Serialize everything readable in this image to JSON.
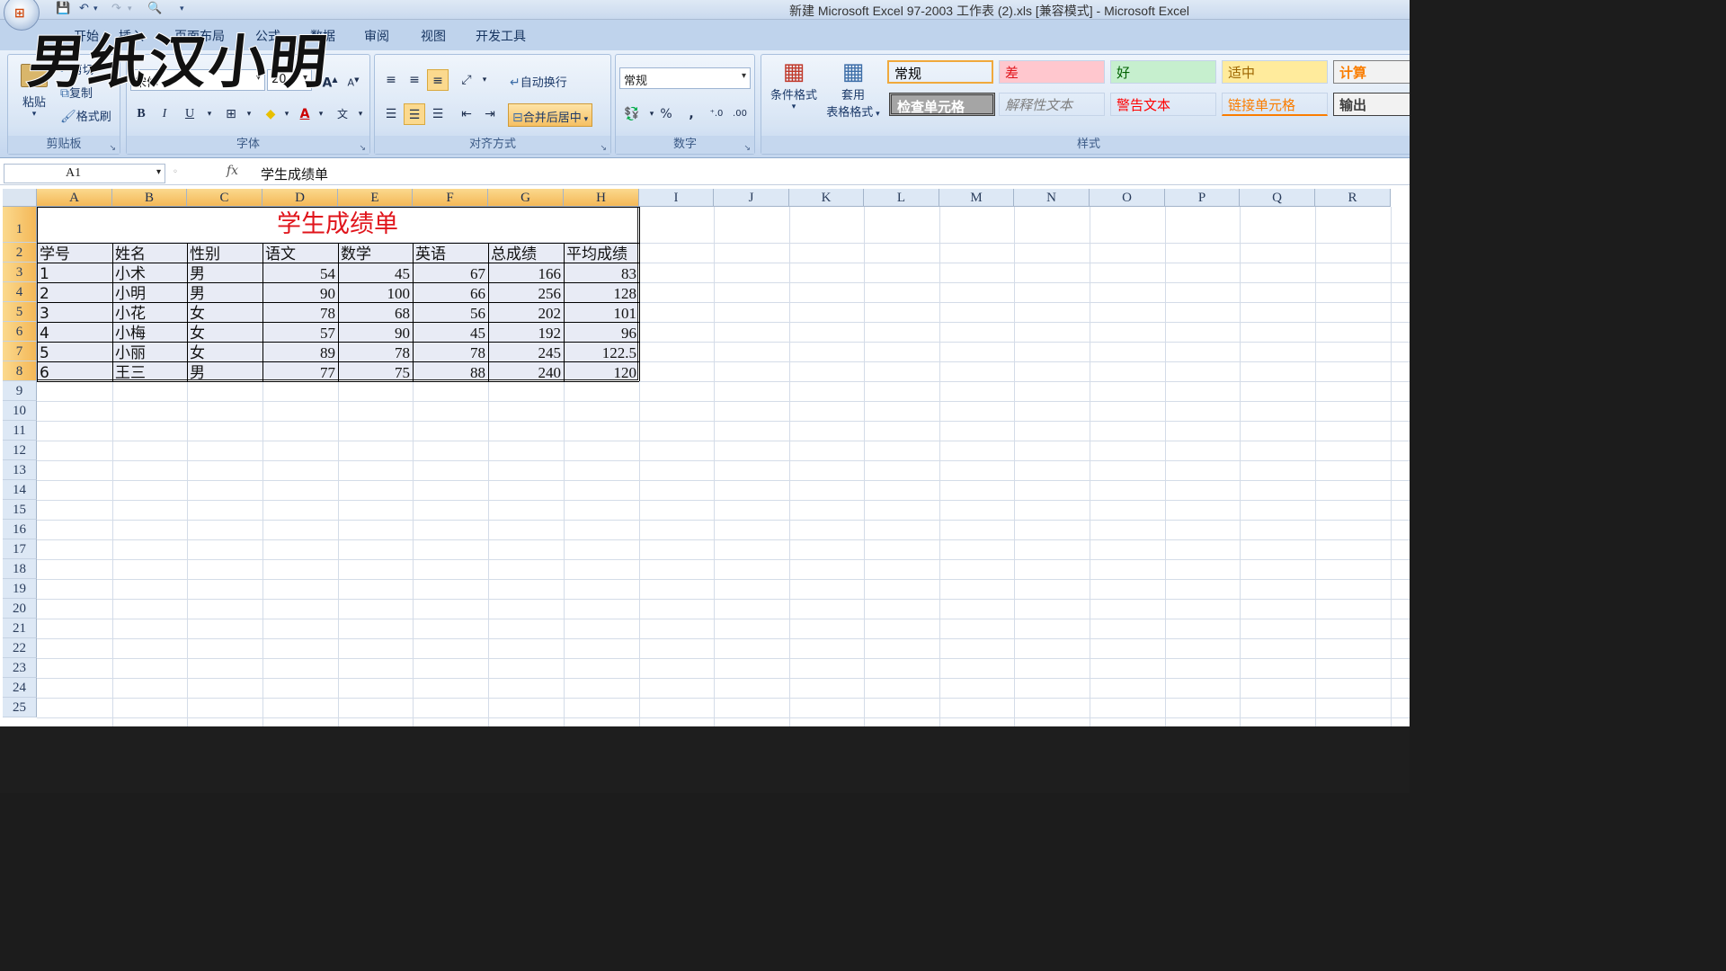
{
  "window": {
    "title": "新建 Microsoft Excel 97-2003 工作表 (2).xls  [兼容模式] - Microsoft Excel",
    "office_button_glyph": "⊞"
  },
  "watermark": "男纸汉小明",
  "tabs": [
    "开始",
    "插入",
    "页面布局",
    "公式",
    "数据",
    "审阅",
    "视图",
    "开发工具"
  ],
  "ribbon": {
    "clipboard": {
      "label": "剪贴板",
      "paste": "粘贴",
      "cut": "剪切",
      "copy": "复制",
      "format_painter": "格式刷"
    },
    "font": {
      "label": "字体",
      "font_name": "宋体",
      "font_size": "20",
      "bold": "B",
      "italic": "I",
      "underline": "U"
    },
    "alignment": {
      "label": "对齐方式",
      "wrap": "自动换行",
      "merge": "合并后居中"
    },
    "number": {
      "label": "数字",
      "format": "常规",
      "percent": "%",
      "comma": ","
    },
    "styles": {
      "label": "样式",
      "conditional": "条件格式",
      "table1": "套用",
      "table2": "表格格式",
      "cells": [
        {
          "text": "常规",
          "color": "#111111",
          "bg": "#ffffff"
        },
        {
          "text": "差",
          "color": "#9c0006",
          "bg": "#ffc7ce"
        },
        {
          "text": "好",
          "color": "#006100",
          "bg": "#c6efce"
        },
        {
          "text": "适中",
          "color": "#9c6500",
          "bg": "#ffeb9c"
        },
        {
          "text": "计算",
          "color": "#fa7d00",
          "bg": "#f2f2f2"
        },
        {
          "text": "检查单元格",
          "color": "#ffffff",
          "bg": "#a5a5a5"
        },
        {
          "text": "解释性文本",
          "color": "#7f7f7f",
          "bg": "#ffffff"
        },
        {
          "text": "警告文本",
          "color": "#ff0000",
          "bg": "#ffffff"
        },
        {
          "text": "链接单元格",
          "color": "#fa7d00",
          "bg": "#ffffff"
        },
        {
          "text": "输出",
          "color": "#3f3f3f",
          "bg": "#f2f2f2"
        }
      ]
    }
  },
  "formula_bar": {
    "name_box": "A1",
    "fx": "fx",
    "content": "学生成绩单"
  },
  "columns": [
    "A",
    "B",
    "C",
    "D",
    "E",
    "F",
    "G",
    "H",
    "I",
    "J",
    "K",
    "L",
    "M",
    "N",
    "O",
    "P",
    "Q",
    "R"
  ],
  "rows": [
    "1",
    "2",
    "3",
    "4",
    "5",
    "6",
    "7",
    "8",
    "9",
    "10",
    "11",
    "12",
    "13",
    "14",
    "15",
    "16",
    "17",
    "18",
    "19",
    "20",
    "21",
    "22",
    "23",
    "24",
    "25"
  ],
  "sheet": {
    "title": "学生成绩单",
    "headers": [
      "学号",
      "姓名",
      "性别",
      "语文",
      "数学",
      "英语",
      "总成绩",
      "平均成绩"
    ],
    "records": [
      [
        "1",
        "小术",
        "男",
        "54",
        "45",
        "67",
        "166",
        "83"
      ],
      [
        "2",
        "小明",
        "男",
        "90",
        "100",
        "66",
        "256",
        "128"
      ],
      [
        "3",
        "小花",
        "女",
        "78",
        "68",
        "56",
        "202",
        "101"
      ],
      [
        "4",
        "小梅",
        "女",
        "57",
        "90",
        "45",
        "192",
        "96"
      ],
      [
        "5",
        "小丽",
        "女",
        "89",
        "78",
        "78",
        "245",
        "122.5"
      ],
      [
        "6",
        "王三",
        "男",
        "77",
        "75",
        "88",
        "240",
        "120"
      ]
    ]
  }
}
